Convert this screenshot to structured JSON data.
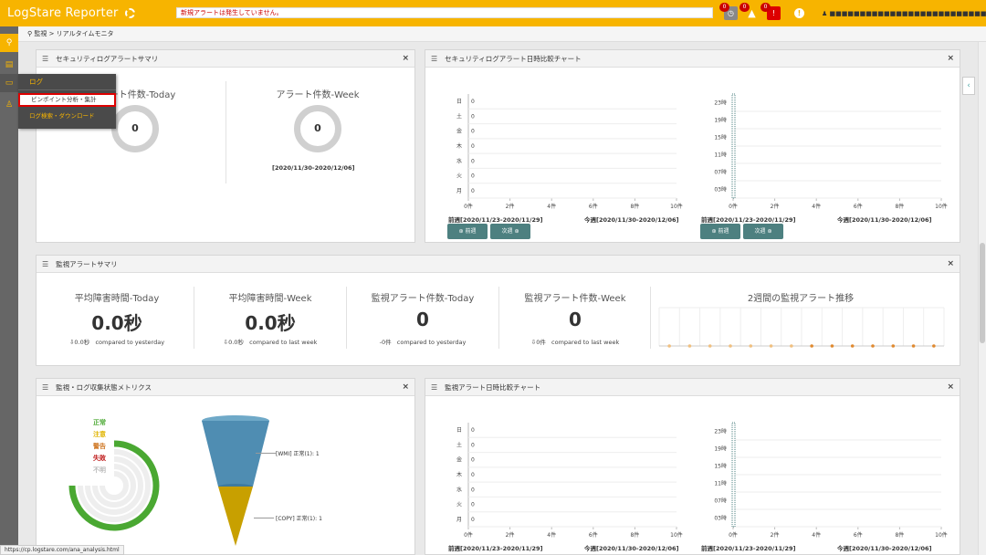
{
  "app": {
    "title": "LogStare Reporter"
  },
  "header": {
    "alert_message": "新規アラートは発生していません。",
    "badge1": "0",
    "badge2": "0",
    "badge3": "0",
    "user_label": "■■■■■■■■■■■■■■■■■■■■■■■■■■"
  },
  "breadcrumb": {
    "text": "監視 > リアルタイムモニタ"
  },
  "menu": {
    "header": "ログ",
    "items": [
      "ピンポイント分析・集計",
      "ログ検索・ダウンロード"
    ]
  },
  "status_url": "https://cp.logstare.com/ana_analysis.html",
  "panels": {
    "sec_summary": {
      "title": "セキュリティログアラートサマリ",
      "today_title": "アラート件数-Today",
      "today_value": "0",
      "week_title": "アラート件数-Week",
      "week_value": "0",
      "week_range": "[2020/11/30-2020/12/06]"
    },
    "sec_chart": {
      "title": "セキュリティログアラート日時比較チャート"
    },
    "mon_summary": {
      "title": "監視アラートサマリ",
      "stats": [
        {
          "title": "平均障害時間-Today",
          "value": "0.0秒",
          "delta": "⇩0.0秒",
          "compare": "compared to yesterday"
        },
        {
          "title": "平均障害時間-Week",
          "value": "0.0秒",
          "delta": "⇩0.0秒",
          "compare": "compared to last week"
        },
        {
          "title": "監視アラート件数-Today",
          "value": "0",
          "delta": "-0件",
          "compare": "compared to yesterday"
        },
        {
          "title": "監視アラート件数-Week",
          "value": "0",
          "delta": "⇩0件",
          "compare": "compared to last week"
        }
      ],
      "trend_title": "2週間の監視アラート推移"
    },
    "metrics": {
      "title": "監視・ログ収集状態メトリクス",
      "legend": [
        {
          "label": "正常",
          "color": "#4aa832"
        },
        {
          "label": "注意",
          "color": "#e0b400"
        },
        {
          "label": "警告",
          "color": "#d07a28"
        },
        {
          "label": "失敗",
          "color": "#c02020"
        },
        {
          "label": "不明",
          "color": "#bbbbbb"
        }
      ],
      "funnel_labels": [
        "[WMI] 正常(1): 1",
        "[COPY] 正常(1): 1"
      ]
    },
    "mon_chart": {
      "title": "監視アラート日時比較チャート"
    }
  },
  "nav": {
    "prev": "前週",
    "next": "次週"
  },
  "chart_data": [
    {
      "type": "bar",
      "orientation": "horizontal",
      "categories": [
        "日",
        "土",
        "金",
        "木",
        "水",
        "火",
        "月"
      ],
      "values": [
        0,
        0,
        0,
        0,
        0,
        0,
        0
      ],
      "x_ticks": [
        "0件",
        "2件",
        "4件",
        "6件",
        "8件",
        "10件"
      ],
      "xlim": [
        0,
        10
      ],
      "prev_range": "前週[2020/11/23-2020/11/29]",
      "curr_range": "今週[2020/11/30-2020/12/06]"
    },
    {
      "type": "bar",
      "orientation": "horizontal",
      "y_ticks": [
        "23時",
        "19時",
        "15時",
        "11時",
        "07時",
        "03時"
      ],
      "x_ticks": [
        "0件",
        "2件",
        "4件",
        "6件",
        "8件",
        "10件"
      ],
      "xlim": [
        0,
        10
      ],
      "prev_range": "前週[2020/11/23-2020/11/29]",
      "curr_range": "今週[2020/11/30-2020/12/06]"
    },
    {
      "type": "line",
      "title": "2週間の監視アラート推移",
      "values": [
        0,
        0,
        0,
        0,
        0,
        0,
        0,
        0,
        0,
        0,
        0,
        0,
        0,
        0
      ]
    },
    {
      "type": "bar",
      "orientation": "horizontal",
      "categories": [
        "日",
        "土",
        "金",
        "木",
        "水",
        "火",
        "月"
      ],
      "values": [
        0,
        0,
        0,
        0,
        0,
        0,
        0
      ],
      "x_ticks": [
        "0件",
        "2件",
        "4件",
        "6件",
        "8件",
        "10件"
      ],
      "xlim": [
        0,
        10
      ],
      "prev_range": "前週[2020/11/23-2020/11/29]",
      "curr_range": "今週[2020/11/30-2020/12/06]"
    },
    {
      "type": "bar",
      "orientation": "horizontal",
      "y_ticks": [
        "23時",
        "19時",
        "15時",
        "11時",
        "07時",
        "03時"
      ],
      "x_ticks": [
        "0件",
        "2件",
        "4件",
        "6件",
        "8件",
        "10件"
      ],
      "xlim": [
        0,
        10
      ],
      "prev_range": "前週[2020/11/23-2020/11/29]",
      "curr_range": "今週[2020/11/30-2020/12/06]"
    }
  ]
}
